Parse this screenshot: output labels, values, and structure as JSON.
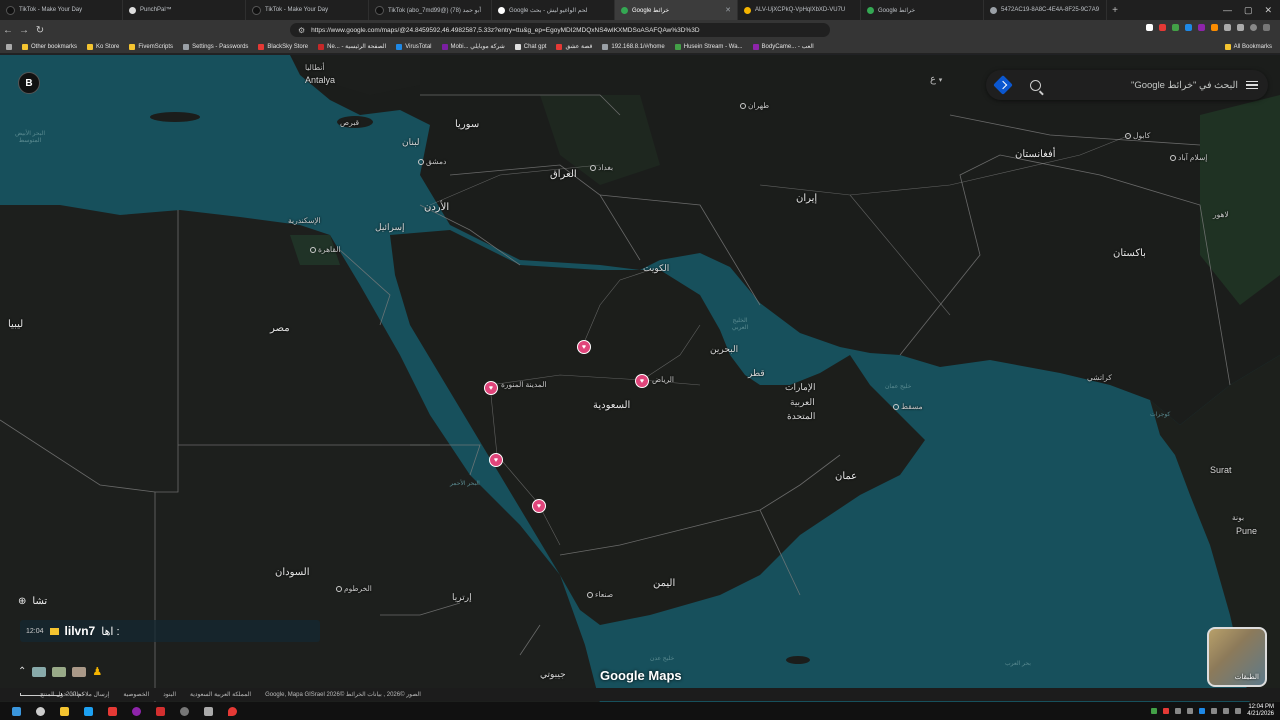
{
  "browser": {
    "tabs": [
      {
        "title": "TikTok - Make Your Day",
        "active": false
      },
      {
        "title": "PunchPal™",
        "active": false
      },
      {
        "title": "TikTok - Make Your Day",
        "active": false
      },
      {
        "title": "TikTok (abo_7md99@) أبو حمد (78)",
        "active": false
      },
      {
        "title": "Google لحم الواغيو ليش - بحث",
        "active": false
      },
      {
        "title": "Google خرائط",
        "active": true
      },
      {
        "title": "ALV-UjXCPkQ-VpHqlXbXD-VU7U",
        "active": false
      },
      {
        "title": "Google خرائط",
        "active": false
      },
      {
        "title": "5472AC19-8A8C-4E4A-8F25-9C7A9",
        "active": false
      }
    ],
    "new_tab": "+",
    "url": "https://www.google.com/maps/@24.8459592,46.4982587,5.33z?entry=ttu&g_ep=EgoyMDI2MDQxNS4wIKXMDSoASAFQAw%3D%3D",
    "bookmarks": [
      "Other bookmarks",
      "Ko Store",
      "FivemScripts",
      "Settings - Passwords",
      "BlackSky Store",
      "Ne... - الصفحة الرئيسية",
      "VirusTotal",
      "Mobi... شركة موبايلي",
      "Chat gpt",
      "قصة عشق",
      "192.168.8.1/#/home",
      "Husein Stream - Wa...",
      "BodyCame... - العب"
    ],
    "all_bookmarks": "All Bookmarks"
  },
  "map": {
    "search_placeholder": "البحث في \"خرائط Google\"",
    "chip_text": "ع",
    "layers_label": "الطبقات",
    "logo_text": "Google Maps",
    "labels": {
      "antalya": "Antalya",
      "antalya_ar": "أنطاليا",
      "cyprus": "قبرص",
      "syria": "سوريا",
      "lebanon": "لبنان",
      "damascus": "دمشق",
      "iraq": "العراق",
      "baghdad": "بغداد",
      "jordan": "الأردن",
      "israel": "إسرائيل",
      "alexandria": "الإسكندرية",
      "cairo": "القاهرة",
      "egypt": "مصر",
      "libya": "ليبيا",
      "kuwait": "الكويت",
      "iran": "إيران",
      "tehran": "طهران",
      "afghanistan": "أفغانستان",
      "kabul": "كابول",
      "islamabad": "إسلام آباد",
      "lahore": "لاهور",
      "pakistan": "باكستان",
      "karachi": "كراتشي",
      "bahrain": "البحرين",
      "qatar": "قطر",
      "uae1": "الإمارات",
      "uae2": "العربية",
      "uae3": "المتحدة",
      "muscat": "مسقط",
      "oman": "عمان",
      "riyadh": "الرياض",
      "saudi": "السعودية",
      "medina": "المدينة المنورة",
      "yemen": "اليمن",
      "sanaa": "صنعاء",
      "sudan": "السودان",
      "khartoum": "الخرطوم",
      "eritrea": "إرتريا",
      "djibouti": "جيبوتي",
      "surat": "Surat",
      "pune": "Pune",
      "pune_ar": "بونة",
      "med_sea": "البحر الأبيض المتوسط",
      "red_sea": "البحر الأحمر",
      "gulf": "الخليج العربي",
      "gulf_oman": "خليج عمان",
      "arabian_sea": "بحر العرب",
      "gulf_aden": "خليج عدن",
      "gujarat": "كوجرات"
    }
  },
  "overlay": {
    "avatar_text": "B",
    "top_text": "تشا",
    "chat_time": "12:04",
    "chat_nick": "lilvn7",
    "chat_msg": "اها :"
  },
  "footer": {
    "scale": "200 كم",
    "items": [
      "الصور ©2026 , بيانات الخرائط ©2026 Google, Mapa GISrael",
      "المملكة العربية السعودية",
      "البنود",
      "الخصوصية",
      "إرسال ملاحظات حول المنتج"
    ]
  },
  "taskbar": {
    "time": "12:04 PM",
    "date": "4/21/2026"
  }
}
